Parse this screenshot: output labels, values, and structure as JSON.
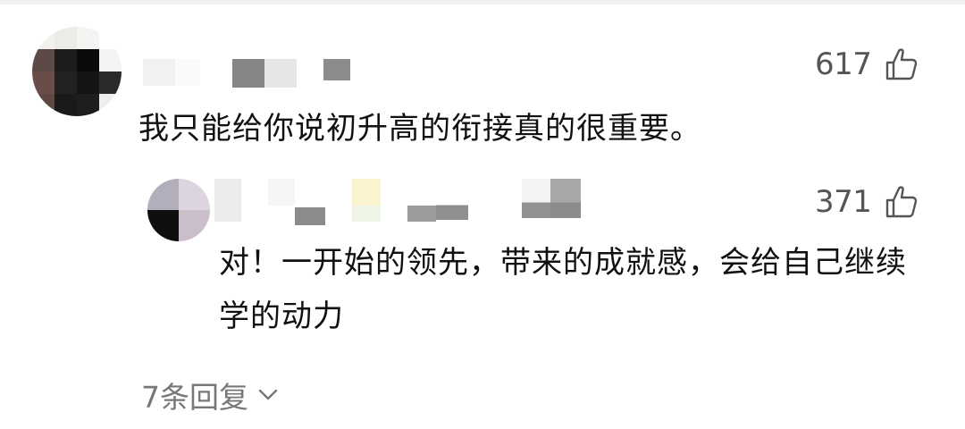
{
  "comment": {
    "likes": "617",
    "text": "我只能给你说初升高的衔接真的很重要。"
  },
  "reply": {
    "likes": "371",
    "text": "对！一开始的领先，带来的成就感，会给自己继续学的动力"
  },
  "more_replies": {
    "label": "7条回复"
  },
  "icons": {
    "like": "thumbs-up-icon",
    "expand": "chevron-down-icon"
  },
  "colors": {
    "text": "#111111",
    "meta": "#555555",
    "link": "#777777"
  }
}
